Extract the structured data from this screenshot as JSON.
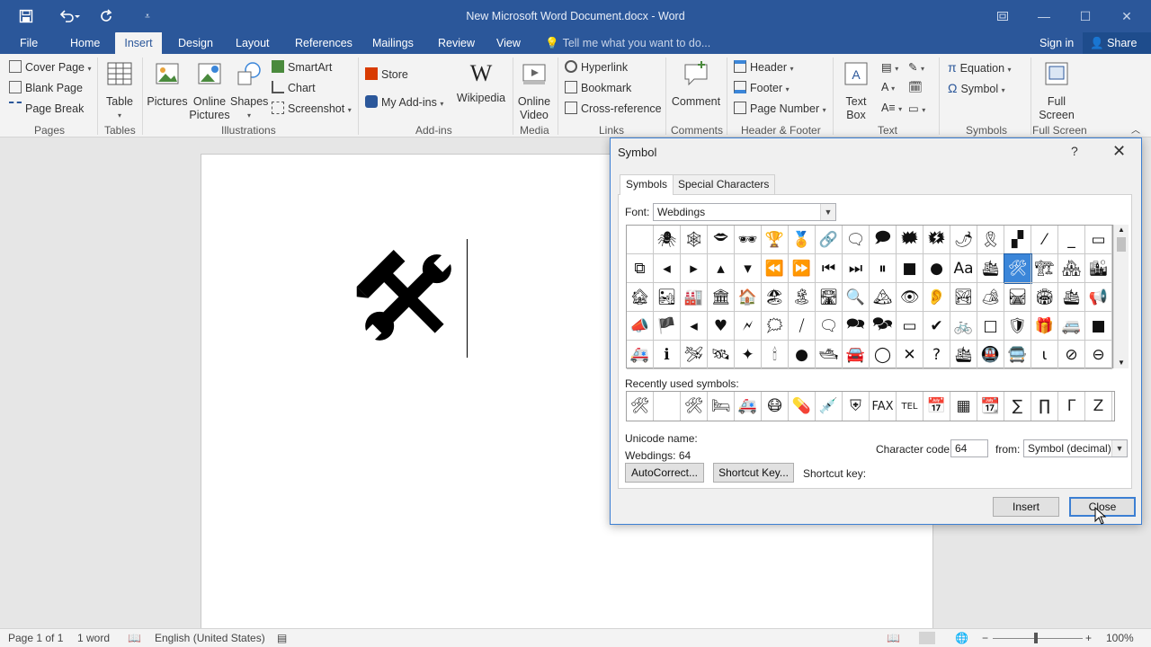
{
  "titlebar": {
    "title": "New Microsoft Word Document.docx - Word",
    "save_icon": "save-icon",
    "undo_icon": "undo-icon",
    "redo_icon": "redo-icon",
    "customize_icon": "customize-qat-icon",
    "ribbon_display_icon": "ribbon-display-icon",
    "minimize": "—",
    "maximize": "☐",
    "close": "✕"
  },
  "tabs": [
    "File",
    "Home",
    "Insert",
    "Design",
    "Layout",
    "References",
    "Mailings",
    "Review",
    "View"
  ],
  "active_tab": "Insert",
  "tell_me": "Tell me what you want to do...",
  "sign_in": "Sign in",
  "share": "Share",
  "ribbon": {
    "pages": {
      "cover": "Cover Page",
      "blank": "Blank Page",
      "break": "Page Break",
      "group": "Pages"
    },
    "tables": {
      "table": "Table",
      "group": "Tables"
    },
    "illustrations": {
      "pictures": "Pictures",
      "online_pictures": "Online Pictures",
      "shapes": "Shapes",
      "smartart": "SmartArt",
      "chart": "Chart",
      "screenshot": "Screenshot",
      "group": "Illustrations"
    },
    "addins": {
      "store": "Store",
      "my_addins": "My Add-ins",
      "wikipedia": "Wikipedia",
      "group": "Add-ins"
    },
    "media": {
      "online_video": "Online Video",
      "group": "Media"
    },
    "links": {
      "hyperlink": "Hyperlink",
      "bookmark": "Bookmark",
      "crossref": "Cross-reference",
      "group": "Links"
    },
    "comments": {
      "comment": "Comment",
      "group": "Comments"
    },
    "header_footer": {
      "header": "Header",
      "footer": "Footer",
      "page_number": "Page Number",
      "group": "Header & Footer"
    },
    "text": {
      "text_box": "Text Box",
      "group": "Text"
    },
    "symbols": {
      "equation": "Equation",
      "symbol": "Symbol",
      "group": "Symbols"
    },
    "fullscreen": {
      "label": "Full Screen",
      "group": "Full Screen"
    }
  },
  "document": {
    "inserted_symbol": "🛠"
  },
  "dialog": {
    "title": "Symbol",
    "help": "?",
    "close": "✕",
    "tabs": [
      "Symbols",
      "Special Characters"
    ],
    "font_label": "Font:",
    "font_value": "Webdings",
    "symbols_rows": [
      [
        "",
        "🕷",
        "🕸",
        "🗢",
        "🕶",
        "🏆",
        "🏅",
        "🔗",
        "🗨",
        "🗩",
        "🗰",
        "🗱",
        "🌶",
        "🎗",
        "▞",
        "⁄",
        "_",
        "▭"
      ],
      [
        "⧉",
        "◂",
        "▸",
        "▴",
        "▾",
        "⏪",
        "⏩",
        "⏮",
        "⏭",
        "⏸",
        "■",
        "●",
        "Aa",
        "🛳",
        "🛠",
        "🏗",
        "🏘",
        "🏙"
      ],
      [
        "🏚",
        "🏜",
        "🏭",
        "🏛",
        "🏠",
        "🏖",
        "🏝",
        "🛣",
        "🔍",
        "🏔",
        "👁",
        "👂",
        "🏞",
        "🏕",
        "🛤",
        "🏟",
        "🛳",
        "📢"
      ],
      [
        "📣",
        "🏴",
        "◂",
        "♥",
        "🗲",
        "🗯",
        "⧸",
        "🗨",
        "🗪",
        "🗫",
        "▭",
        "✔",
        "🚲",
        "□",
        "🛡",
        "🎁",
        "🚐",
        "■"
      ],
      [
        "🚑",
        "ℹ",
        "🛩",
        "🛰",
        "✦",
        "🕯",
        "●",
        "🛥",
        "🚘",
        "◯",
        "✕",
        "?",
        "🛳",
        "🚇",
        "🚍",
        "⍳",
        "⊘",
        "⊖"
      ]
    ],
    "selected_row": 1,
    "selected_col": 14,
    "recently_label": "Recently used symbols:",
    "recent": [
      "🛠",
      "",
      "🛠",
      "🛏",
      "🚑",
      "😷",
      "💊",
      "💉",
      "⛨",
      "FAX",
      "TEL",
      "📅",
      "▦",
      "📆",
      "∑",
      "∏",
      "Γ",
      "Z"
    ],
    "unicode_name_label": "Unicode name:",
    "unicode_name_value": "Webdings: 64",
    "char_code_label": "Character code:",
    "char_code_value": "64",
    "from_label": "from:",
    "from_value": "Symbol (decimal)",
    "autocorrect": "AutoCorrect...",
    "shortcut_key_btn": "Shortcut Key...",
    "shortcut_key_label": "Shortcut key:",
    "insert": "Insert",
    "close_btn": "Close"
  },
  "status": {
    "page": "Page 1 of 1",
    "words": "1 word",
    "language": "English (United States)",
    "zoom": "100%"
  },
  "colors": {
    "accent": "#2b579a",
    "selection": "#3b86d9"
  }
}
